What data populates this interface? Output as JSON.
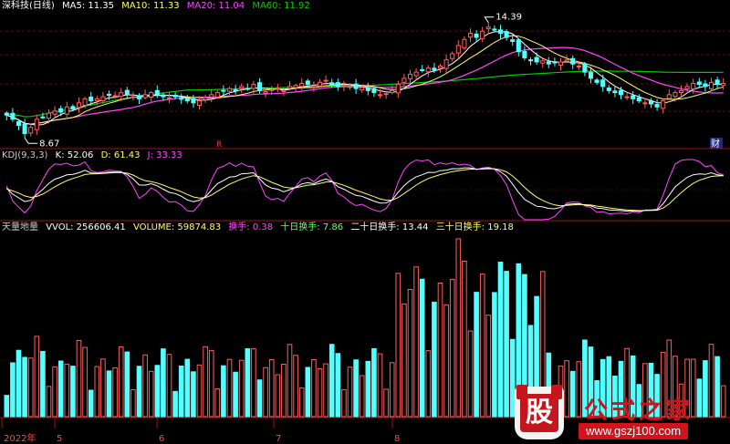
{
  "colors": {
    "background": "#000000",
    "up": "#ff5e5e",
    "down": "#54ffff",
    "ma5": "#ffffff",
    "ma10": "#ffff66",
    "ma20": "#ff44ff",
    "ma60": "#00cc00",
    "turnover_highlight": "#66dd44",
    "separator": "#a01010"
  },
  "main_header": {
    "stock": "深科技(日线)",
    "ma5": "MA5: 11.35",
    "ma10": "MA10: 11.33",
    "ma20": "MA20: 11.04",
    "ma60": "MA60: 11.92"
  },
  "kdj_header": {
    "name": "KDJ(9,3,3)",
    "k": "K: 52.06",
    "d": "D: 61.43",
    "j": "J: 33.33"
  },
  "vol_header": {
    "name": "天量地量",
    "vvol": "VVOL: 256606.41",
    "volume": "VOLUME: 59874.83",
    "hs": "换手: 0.38",
    "hs10": "十日换手: 7.86",
    "hs20": "二十日换手: 13.44",
    "hs30": "三十日换手: 19.18"
  },
  "watermark": {
    "logo_char": "股",
    "title": "公式之家",
    "url": "www.gszj100.com"
  },
  "chart_data": [
    {
      "panel": "price",
      "type": "candlestick",
      "annotations": [
        {
          "label": "14.39",
          "at": "high"
        },
        {
          "label": "8.67",
          "at": "low"
        }
      ],
      "markers": [
        "R",
        "财"
      ],
      "series": [
        {
          "name": "MA5",
          "value": 11.35
        },
        {
          "name": "MA10",
          "value": 11.33
        },
        {
          "name": "MA20",
          "value": 11.04
        },
        {
          "name": "MA60",
          "value": 11.92
        }
      ],
      "close": [
        9.8,
        9.6,
        9.3,
        8.9,
        9.2,
        9.6,
        9.7,
        9.9,
        10.0,
        9.95,
        10.2,
        10.1,
        10.4,
        10.6,
        10.5,
        10.6,
        10.7,
        10.8,
        10.75,
        10.9,
        10.8,
        10.7,
        10.6,
        10.8,
        10.9,
        10.8,
        10.7,
        10.65,
        10.7,
        10.6,
        10.5,
        10.4,
        10.5,
        10.65,
        10.8,
        10.9,
        11.0,
        11.1,
        11.0,
        11.2,
        11.1,
        11.3,
        11.0,
        10.95,
        11.05,
        11.1,
        11.0,
        11.2,
        11.25,
        11.35,
        11.3,
        11.2,
        11.4,
        11.5,
        11.3,
        11.2,
        11.25,
        11.2,
        11.1,
        11.15,
        11.0,
        10.9,
        10.8,
        10.85,
        11.0,
        11.3,
        11.6,
        11.8,
        11.9,
        12.0,
        12.1,
        12.0,
        12.2,
        12.5,
        12.8,
        13.2,
        13.5,
        13.8,
        13.6,
        13.9,
        14.1,
        13.95,
        13.8,
        13.6,
        13.4,
        12.9,
        12.6,
        12.5,
        12.4,
        12.45,
        12.3,
        12.35,
        12.4,
        12.5,
        12.3,
        12.2,
        11.9,
        11.6,
        11.4,
        11.2,
        11.0,
        10.9,
        10.8,
        10.7,
        10.6,
        10.5,
        10.4,
        10.35,
        10.2,
        10.5,
        10.8,
        10.9,
        11.0,
        11.2,
        11.35,
        11.3,
        11.2,
        11.4,
        11.3,
        11.35
      ]
    },
    {
      "panel": "kdj",
      "type": "line",
      "series": [
        {
          "name": "K",
          "value": 52.06
        },
        {
          "name": "D",
          "value": 61.43
        },
        {
          "name": "J",
          "value": 33.33
        }
      ]
    },
    {
      "panel": "volume",
      "type": "bar",
      "xlabels": [
        "2022年",
        "5",
        "6",
        "7",
        "8"
      ],
      "series": [
        {
          "name": "VVOL",
          "value": 256606.41
        },
        {
          "name": "VOLUME",
          "value": 59874.83
        }
      ]
    }
  ]
}
